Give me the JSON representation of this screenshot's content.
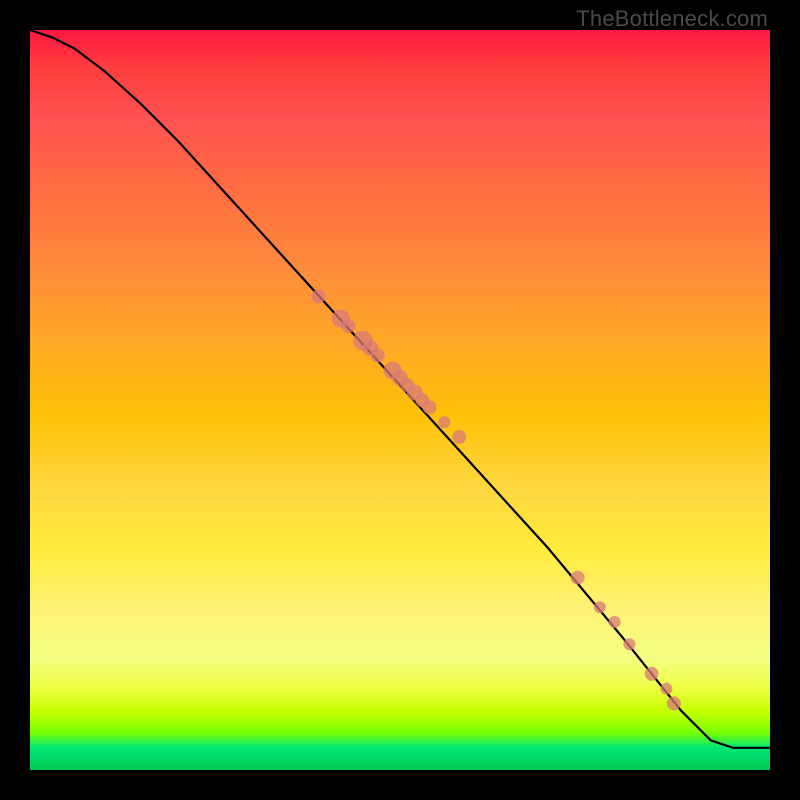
{
  "watermark": "TheBottleneck.com",
  "chart_data": {
    "type": "line",
    "title": "",
    "xlabel": "",
    "ylabel": "",
    "xlim": [
      0,
      100
    ],
    "ylim": [
      0,
      100
    ],
    "series": [
      {
        "name": "curve",
        "x": [
          0,
          3,
          6,
          10,
          15,
          20,
          30,
          40,
          50,
          60,
          70,
          80,
          88,
          92,
          95,
          100
        ],
        "y": [
          100,
          99,
          97.5,
          94.5,
          90,
          85,
          74,
          63,
          52,
          41,
          30,
          18,
          8,
          4,
          3,
          3
        ]
      }
    ],
    "markers": [
      {
        "x": 39,
        "y": 64,
        "r": 7
      },
      {
        "x": 42,
        "y": 61,
        "r": 9
      },
      {
        "x": 43,
        "y": 60,
        "r": 7
      },
      {
        "x": 45,
        "y": 58,
        "r": 10
      },
      {
        "x": 46,
        "y": 57,
        "r": 8
      },
      {
        "x": 47,
        "y": 56,
        "r": 7
      },
      {
        "x": 49,
        "y": 54,
        "r": 9
      },
      {
        "x": 50,
        "y": 53,
        "r": 8
      },
      {
        "x": 51,
        "y": 52,
        "r": 7
      },
      {
        "x": 52,
        "y": 51,
        "r": 8
      },
      {
        "x": 53,
        "y": 50,
        "r": 7
      },
      {
        "x": 54,
        "y": 49,
        "r": 7
      },
      {
        "x": 56,
        "y": 47,
        "r": 6
      },
      {
        "x": 58,
        "y": 45,
        "r": 7
      },
      {
        "x": 74,
        "y": 26,
        "r": 7
      },
      {
        "x": 77,
        "y": 22,
        "r": 6
      },
      {
        "x": 79,
        "y": 20,
        "r": 6
      },
      {
        "x": 81,
        "y": 17,
        "r": 6
      },
      {
        "x": 84,
        "y": 13,
        "r": 7
      },
      {
        "x": 86,
        "y": 11,
        "r": 6
      },
      {
        "x": 87,
        "y": 9,
        "r": 7
      }
    ]
  }
}
